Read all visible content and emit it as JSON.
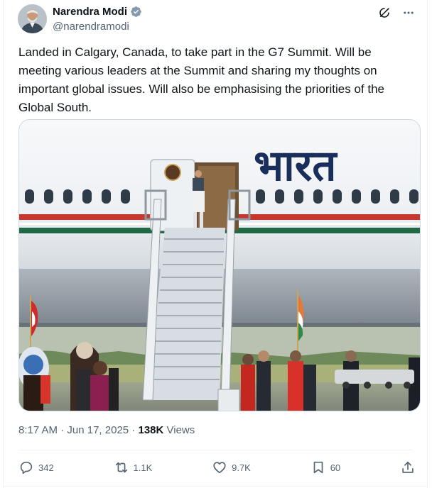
{
  "author": {
    "name": "Narendra Modi",
    "handle": "@narendramodi",
    "verified": true
  },
  "tweet": {
    "text": "Landed in Calgary, Canada, to take part in the G7 Summit. Will be meeting various leaders at the Summit and sharing my thoughts on important global issues. Will also be emphasising the priorities of the Global South."
  },
  "media": {
    "aircraft_lettering": "भारत"
  },
  "meta": {
    "time": "8:17 AM",
    "separator1": " · ",
    "date": "Jun 17, 2025",
    "separator2": " · ",
    "views_count": "138K",
    "views_label": " Views"
  },
  "actions": {
    "replies": "342",
    "reposts": "1.1K",
    "likes": "9.7K",
    "bookmarks": "60"
  },
  "icons": [
    "verified-badge-icon",
    "grok-icon",
    "more-icon",
    "reply-icon",
    "repost-icon",
    "like-icon",
    "bookmark-icon",
    "share-icon"
  ],
  "colors": {
    "verified_badge": "#829aab",
    "text": "#0f1419",
    "secondary": "#536471"
  }
}
